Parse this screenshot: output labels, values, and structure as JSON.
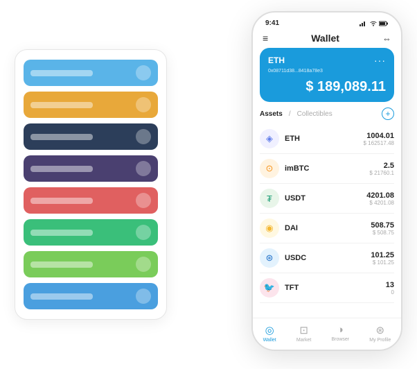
{
  "scene": {
    "cardStack": {
      "cards": [
        {
          "color": "#5ab4e8",
          "textColor": "rgba(255,255,255,0.5)"
        },
        {
          "color": "#e8a83a",
          "textColor": "rgba(255,255,255,0.5)"
        },
        {
          "color": "#2c3e5a",
          "textColor": "rgba(255,255,255,0.3)"
        },
        {
          "color": "#4a4070",
          "textColor": "rgba(255,255,255,0.3)"
        },
        {
          "color": "#e06060",
          "textColor": "rgba(255,255,255,0.4)"
        },
        {
          "color": "#3abf7a",
          "textColor": "rgba(255,255,255,0.4)"
        },
        {
          "color": "#7acc5a",
          "textColor": "rgba(255,255,255,0.4)"
        },
        {
          "color": "#4a9fdf",
          "textColor": "rgba(255,255,255,0.4)"
        }
      ]
    },
    "phone": {
      "time": "9:41",
      "header": {
        "title": "Wallet"
      },
      "ethCard": {
        "label": "ETH",
        "address": "0x08711d38...8418a78e3",
        "balance": "$ 189,089.11"
      },
      "assetsTabs": {
        "active": "Assets",
        "secondary": "Collectibles"
      },
      "assets": [
        {
          "name": "ETH",
          "icon": "◈",
          "iconBg": "#f0f0ff",
          "iconColor": "#627eea",
          "amount": "1004.01",
          "usd": "$ 162517.48"
        },
        {
          "name": "imBTC",
          "icon": "⊙",
          "iconBg": "#fff3e0",
          "iconColor": "#f7931a",
          "amount": "2.5",
          "usd": "$ 21760.1"
        },
        {
          "name": "USDT",
          "icon": "₮",
          "iconBg": "#e8f5e9",
          "iconColor": "#26a17b",
          "amount": "4201.08",
          "usd": "$ 4201.08"
        },
        {
          "name": "DAI",
          "icon": "◉",
          "iconBg": "#fff8e1",
          "iconColor": "#f4b731",
          "amount": "508.75",
          "usd": "$ 508.75"
        },
        {
          "name": "USDC",
          "icon": "⊛",
          "iconBg": "#e3f2fd",
          "iconColor": "#2775ca",
          "amount": "101.25",
          "usd": "$ 101.25"
        },
        {
          "name": "TFT",
          "icon": "🐦",
          "iconBg": "#fce4ec",
          "iconColor": "#e91e63",
          "amount": "13",
          "usd": "0"
        }
      ],
      "bottomNav": [
        {
          "icon": "◎",
          "label": "Wallet",
          "active": true
        },
        {
          "icon": "⊏",
          "label": "Market",
          "active": false
        },
        {
          "icon": "⊙",
          "label": "Browser",
          "active": false
        },
        {
          "icon": "⊛",
          "label": "My Profile",
          "active": false
        }
      ]
    }
  }
}
